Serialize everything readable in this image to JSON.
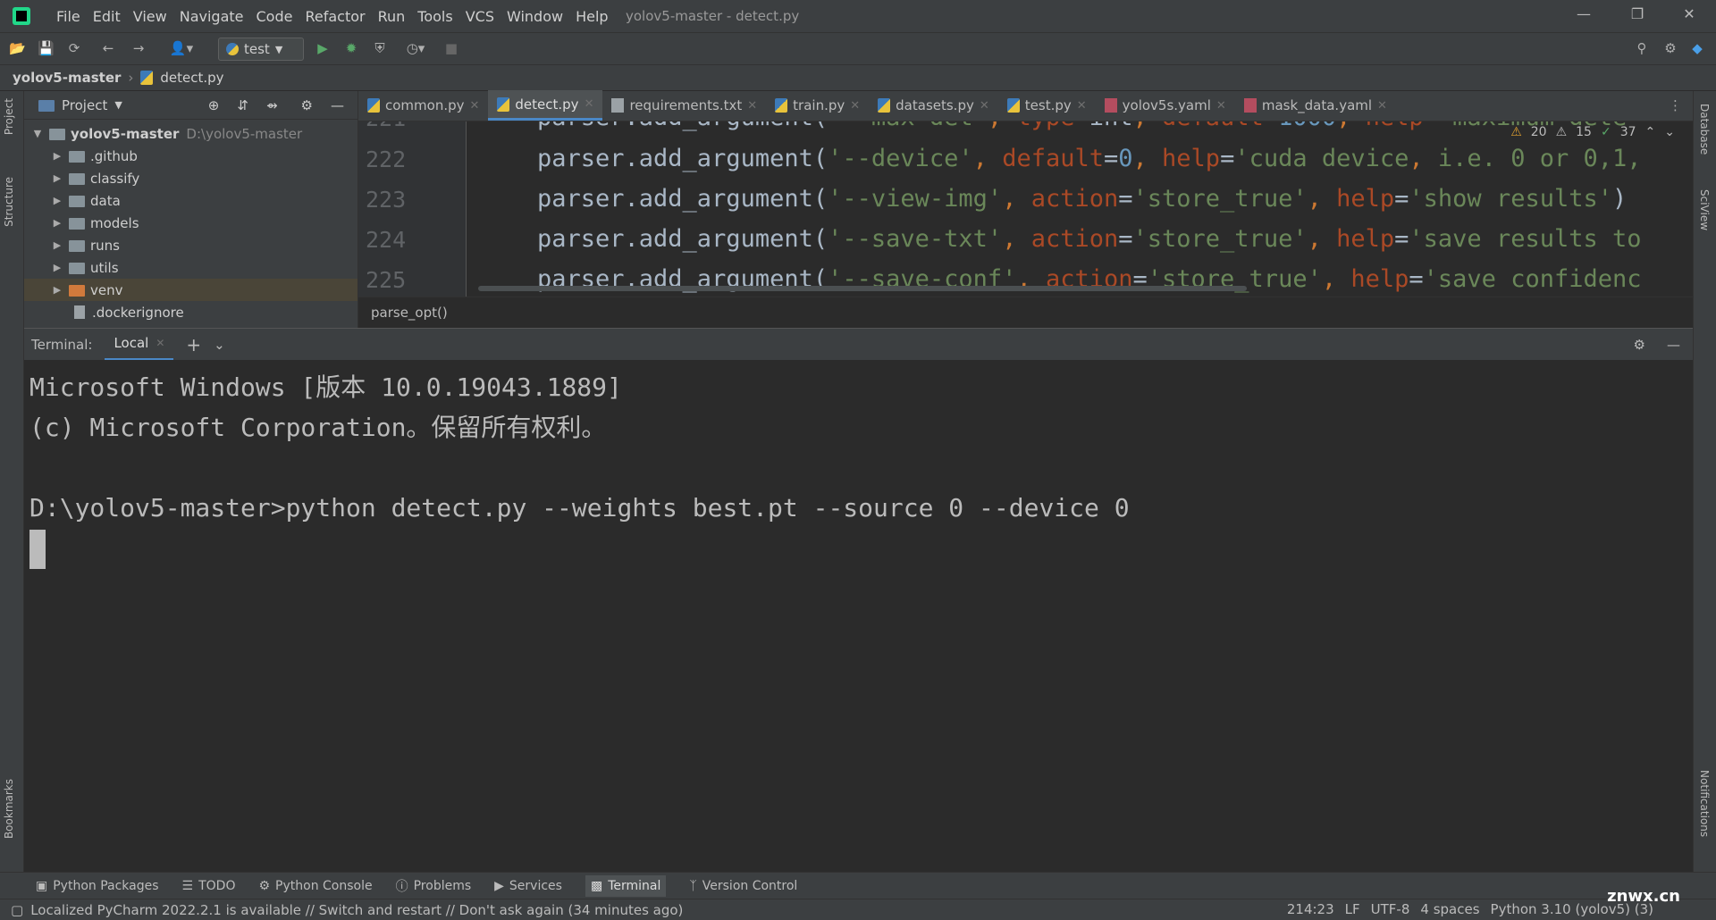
{
  "menu": [
    "File",
    "Edit",
    "View",
    "Navigate",
    "Code",
    "Refactor",
    "Run",
    "Tools",
    "VCS",
    "Window",
    "Help"
  ],
  "window_title": "yolov5-master - detect.py",
  "run_config": "test",
  "breadcrumb": {
    "project": "yolov5-master",
    "file": "detect.py"
  },
  "project_panel": {
    "title": "Project",
    "root": {
      "name": "yolov5-master",
      "path": "D:\\yolov5-master"
    },
    "items": [
      ".github",
      "classify",
      "data",
      "models",
      "runs",
      "utils",
      "venv",
      ".dockerignore"
    ]
  },
  "editor_tabs": [
    {
      "label": "common.py",
      "kind": "py"
    },
    {
      "label": "detect.py",
      "kind": "py",
      "active": true
    },
    {
      "label": "requirements.txt",
      "kind": "txt"
    },
    {
      "label": "train.py",
      "kind": "py"
    },
    {
      "label": "datasets.py",
      "kind": "py"
    },
    {
      "label": "test.py",
      "kind": "py"
    },
    {
      "label": "yolov5s.yaml",
      "kind": "yaml"
    },
    {
      "label": "mask_data.yaml",
      "kind": "yaml"
    }
  ],
  "editor": {
    "inspections": {
      "warnings": "20",
      "weak_warnings": "15",
      "ok": "37"
    },
    "lines": [
      {
        "number": "221",
        "code": "parser.add_argument('--max-det', type=int, default=1000, help='maximum dete"
      },
      {
        "number": "222",
        "code": "parser.add_argument('--device', default=0, help='cuda device, i.e. 0 or 0,1,"
      },
      {
        "number": "223",
        "code": "parser.add_argument('--view-img', action='store_true', help='show results')"
      },
      {
        "number": "224",
        "code": "parser.add_argument('--save-txt', action='store_true', help='save results to"
      },
      {
        "number": "225",
        "code": "parser.add_argument('--save-conf', action='store_true', help='save confidenc"
      }
    ],
    "function_crumb": "parse_opt()"
  },
  "terminal": {
    "label": "Terminal:",
    "tab": "Local",
    "lines": [
      "Microsoft Windows [版本 10.0.19043.1889]",
      "(c) Microsoft Corporation。保留所有权利。",
      "",
      "D:\\yolov5-master>python detect.py --weights best.pt  --source 0  --device 0"
    ]
  },
  "right_stripe": [
    "Database",
    "SciView",
    "Notifications"
  ],
  "left_stripe": [
    "Project",
    "Structure",
    "Bookmarks"
  ],
  "tool_windows": [
    "Python Packages",
    "TODO",
    "Python Console",
    "Problems",
    "Services",
    "Terminal",
    "Version Control"
  ],
  "status": {
    "message": "Localized PyCharm 2022.2.1 is available // Switch and restart // Don't ask again (34 minutes ago)",
    "position": "214:23",
    "line_sep": "LF",
    "encoding": "UTF-8",
    "indent": "4 spaces",
    "interpreter": "Python 3.10 (yolov5) (3)",
    "watermark": "znwx.cn"
  }
}
